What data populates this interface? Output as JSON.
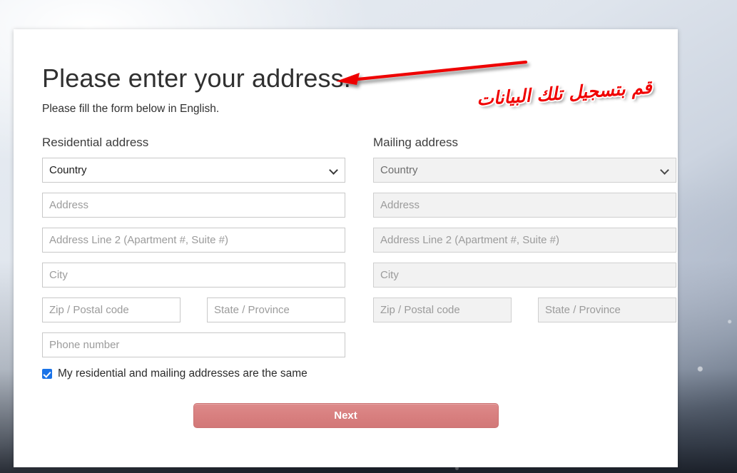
{
  "page": {
    "title": "Please enter your address.",
    "subtitle": "Please fill the form below in English."
  },
  "residential": {
    "heading": "Residential address",
    "country_value": "Country",
    "address_placeholder": "Address",
    "address2_placeholder": "Address Line 2 (Apartment #, Suite #)",
    "city_placeholder": "City",
    "zip_placeholder": "Zip / Postal code",
    "state_placeholder": "State / Province",
    "phone_placeholder": "Phone number"
  },
  "mailing": {
    "heading": "Mailing address",
    "country_value": "Country",
    "address_placeholder": "Address",
    "address2_placeholder": "Address Line 2 (Apartment #, Suite #)",
    "city_placeholder": "City",
    "zip_placeholder": "Zip / Postal code",
    "state_placeholder": "State / Province"
  },
  "same_address": {
    "label": "My residential and mailing addresses are the same",
    "checked": "true",
    "check_color": "#1a73e8"
  },
  "actions": {
    "next_label": "Next",
    "next_color": "#d87f7f"
  },
  "annotations": {
    "arabic_note": "قم بتسجيل تلك البيانات",
    "arrow_color": "#ee0000"
  }
}
